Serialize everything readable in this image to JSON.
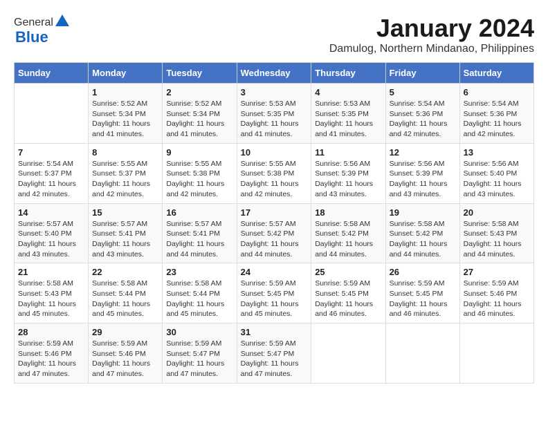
{
  "header": {
    "logo_general": "General",
    "logo_blue": "Blue",
    "main_title": "January 2024",
    "subtitle": "Damulog, Northern Mindanao, Philippines"
  },
  "calendar": {
    "days_of_week": [
      "Sunday",
      "Monday",
      "Tuesday",
      "Wednesday",
      "Thursday",
      "Friday",
      "Saturday"
    ],
    "weeks": [
      [
        {
          "day": "",
          "info": ""
        },
        {
          "day": "1",
          "info": "Sunrise: 5:52 AM\nSunset: 5:34 PM\nDaylight: 11 hours\nand 41 minutes."
        },
        {
          "day": "2",
          "info": "Sunrise: 5:52 AM\nSunset: 5:34 PM\nDaylight: 11 hours\nand 41 minutes."
        },
        {
          "day": "3",
          "info": "Sunrise: 5:53 AM\nSunset: 5:35 PM\nDaylight: 11 hours\nand 41 minutes."
        },
        {
          "day": "4",
          "info": "Sunrise: 5:53 AM\nSunset: 5:35 PM\nDaylight: 11 hours\nand 41 minutes."
        },
        {
          "day": "5",
          "info": "Sunrise: 5:54 AM\nSunset: 5:36 PM\nDaylight: 11 hours\nand 42 minutes."
        },
        {
          "day": "6",
          "info": "Sunrise: 5:54 AM\nSunset: 5:36 PM\nDaylight: 11 hours\nand 42 minutes."
        }
      ],
      [
        {
          "day": "7",
          "info": "Sunrise: 5:54 AM\nSunset: 5:37 PM\nDaylight: 11 hours\nand 42 minutes."
        },
        {
          "day": "8",
          "info": "Sunrise: 5:55 AM\nSunset: 5:37 PM\nDaylight: 11 hours\nand 42 minutes."
        },
        {
          "day": "9",
          "info": "Sunrise: 5:55 AM\nSunset: 5:38 PM\nDaylight: 11 hours\nand 42 minutes."
        },
        {
          "day": "10",
          "info": "Sunrise: 5:55 AM\nSunset: 5:38 PM\nDaylight: 11 hours\nand 42 minutes."
        },
        {
          "day": "11",
          "info": "Sunrise: 5:56 AM\nSunset: 5:39 PM\nDaylight: 11 hours\nand 43 minutes."
        },
        {
          "day": "12",
          "info": "Sunrise: 5:56 AM\nSunset: 5:39 PM\nDaylight: 11 hours\nand 43 minutes."
        },
        {
          "day": "13",
          "info": "Sunrise: 5:56 AM\nSunset: 5:40 PM\nDaylight: 11 hours\nand 43 minutes."
        }
      ],
      [
        {
          "day": "14",
          "info": "Sunrise: 5:57 AM\nSunset: 5:40 PM\nDaylight: 11 hours\nand 43 minutes."
        },
        {
          "day": "15",
          "info": "Sunrise: 5:57 AM\nSunset: 5:41 PM\nDaylight: 11 hours\nand 43 minutes."
        },
        {
          "day": "16",
          "info": "Sunrise: 5:57 AM\nSunset: 5:41 PM\nDaylight: 11 hours\nand 44 minutes."
        },
        {
          "day": "17",
          "info": "Sunrise: 5:57 AM\nSunset: 5:42 PM\nDaylight: 11 hours\nand 44 minutes."
        },
        {
          "day": "18",
          "info": "Sunrise: 5:58 AM\nSunset: 5:42 PM\nDaylight: 11 hours\nand 44 minutes."
        },
        {
          "day": "19",
          "info": "Sunrise: 5:58 AM\nSunset: 5:42 PM\nDaylight: 11 hours\nand 44 minutes."
        },
        {
          "day": "20",
          "info": "Sunrise: 5:58 AM\nSunset: 5:43 PM\nDaylight: 11 hours\nand 44 minutes."
        }
      ],
      [
        {
          "day": "21",
          "info": "Sunrise: 5:58 AM\nSunset: 5:43 PM\nDaylight: 11 hours\nand 45 minutes."
        },
        {
          "day": "22",
          "info": "Sunrise: 5:58 AM\nSunset: 5:44 PM\nDaylight: 11 hours\nand 45 minutes."
        },
        {
          "day": "23",
          "info": "Sunrise: 5:58 AM\nSunset: 5:44 PM\nDaylight: 11 hours\nand 45 minutes."
        },
        {
          "day": "24",
          "info": "Sunrise: 5:59 AM\nSunset: 5:45 PM\nDaylight: 11 hours\nand 45 minutes."
        },
        {
          "day": "25",
          "info": "Sunrise: 5:59 AM\nSunset: 5:45 PM\nDaylight: 11 hours\nand 46 minutes."
        },
        {
          "day": "26",
          "info": "Sunrise: 5:59 AM\nSunset: 5:45 PM\nDaylight: 11 hours\nand 46 minutes."
        },
        {
          "day": "27",
          "info": "Sunrise: 5:59 AM\nSunset: 5:46 PM\nDaylight: 11 hours\nand 46 minutes."
        }
      ],
      [
        {
          "day": "28",
          "info": "Sunrise: 5:59 AM\nSunset: 5:46 PM\nDaylight: 11 hours\nand 47 minutes."
        },
        {
          "day": "29",
          "info": "Sunrise: 5:59 AM\nSunset: 5:46 PM\nDaylight: 11 hours\nand 47 minutes."
        },
        {
          "day": "30",
          "info": "Sunrise: 5:59 AM\nSunset: 5:47 PM\nDaylight: 11 hours\nand 47 minutes."
        },
        {
          "day": "31",
          "info": "Sunrise: 5:59 AM\nSunset: 5:47 PM\nDaylight: 11 hours\nand 47 minutes."
        },
        {
          "day": "",
          "info": ""
        },
        {
          "day": "",
          "info": ""
        },
        {
          "day": "",
          "info": ""
        }
      ]
    ]
  }
}
